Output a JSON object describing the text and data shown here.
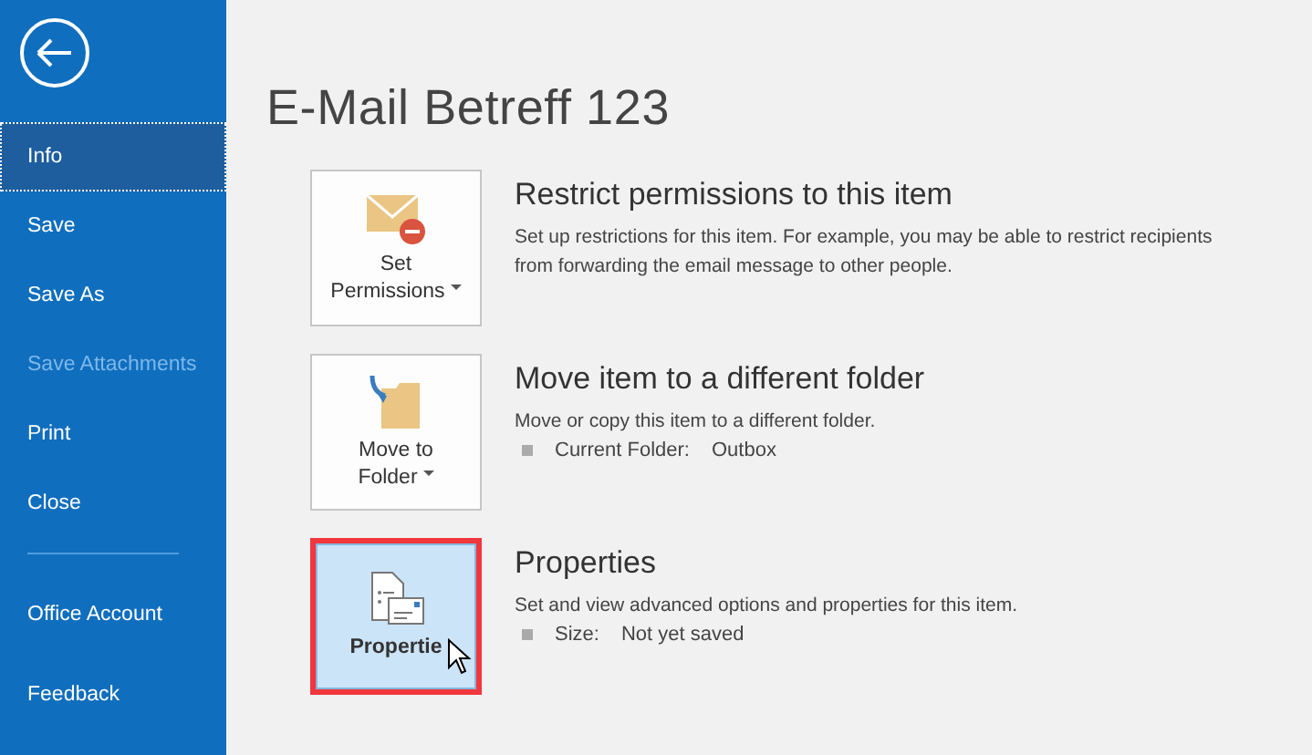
{
  "sidebar": {
    "items": [
      {
        "label": "Info",
        "selected": true,
        "disabled": false,
        "divider_after": false
      },
      {
        "label": "Save",
        "selected": false,
        "disabled": false,
        "divider_after": false
      },
      {
        "label": "Save As",
        "selected": false,
        "disabled": false,
        "divider_after": false
      },
      {
        "label": "Save Attachments",
        "selected": false,
        "disabled": true,
        "divider_after": false
      },
      {
        "label": "Print",
        "selected": false,
        "disabled": false,
        "divider_after": false
      },
      {
        "label": "Close",
        "selected": false,
        "disabled": false,
        "divider_after": true
      },
      {
        "label": "Office Account",
        "selected": false,
        "disabled": false,
        "divider_after": false
      },
      {
        "label": "Feedback",
        "selected": false,
        "disabled": false,
        "divider_after": false
      }
    ]
  },
  "title": "E-Mail Betreff 123",
  "sections": [
    {
      "kind": "permissions",
      "button_lines": [
        "Set",
        "Permissions"
      ],
      "dropdown": true,
      "highlighted": false,
      "heading": "Restrict permissions to this item",
      "description": [
        "Set up restrictions for this item. For example, you may be able to restrict recipients",
        "from forwarding the email message to other people."
      ]
    },
    {
      "kind": "move",
      "button_lines": [
        "Move to",
        "Folder"
      ],
      "dropdown": true,
      "highlighted": false,
      "heading": "Move item to a different folder",
      "description": [
        "Move or copy this item to a different folder."
      ],
      "detail": {
        "label": "Current Folder:",
        "value": "Outbox"
      }
    },
    {
      "kind": "properties",
      "button_lines": [
        "Propertie"
      ],
      "dropdown": false,
      "highlighted": true,
      "heading": "Properties",
      "description": [
        "Set and view advanced options and properties for this item."
      ],
      "detail": {
        "label": "Size:",
        "value": "Not yet saved"
      }
    }
  ]
}
